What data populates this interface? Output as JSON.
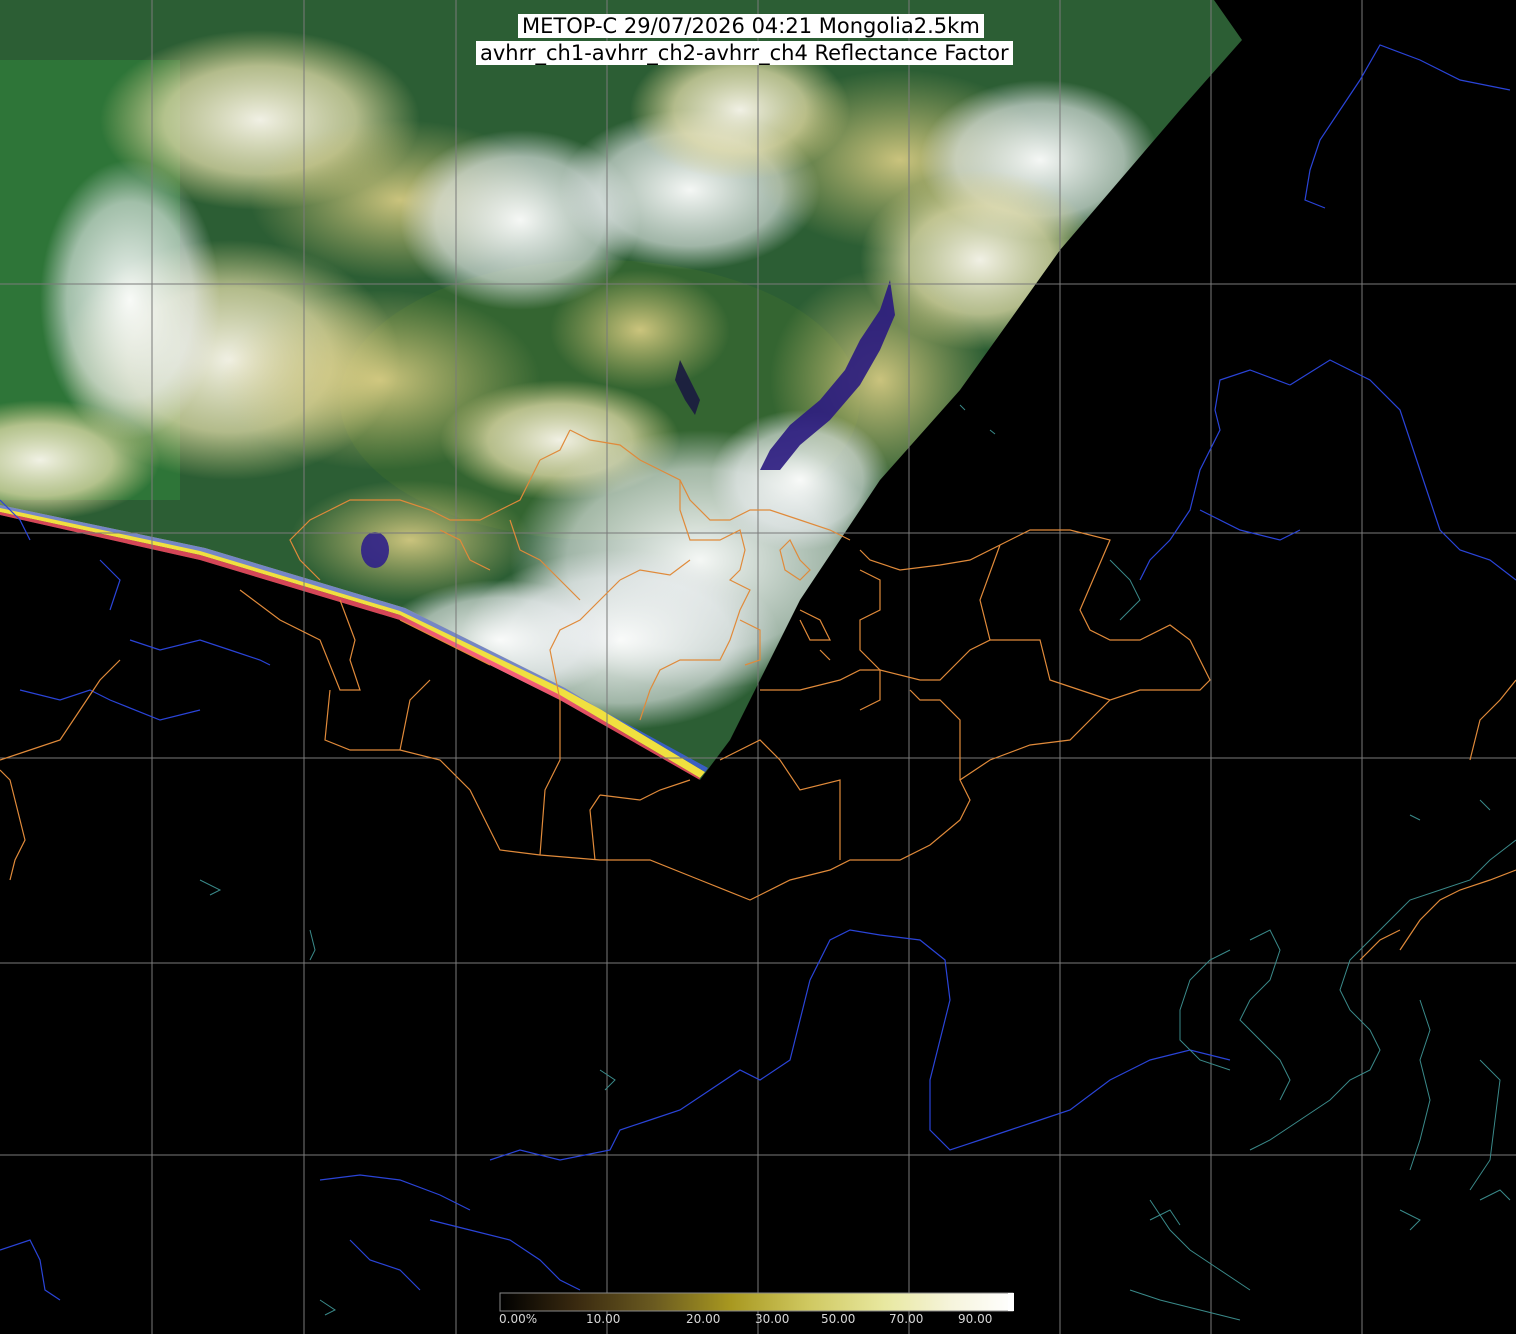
{
  "title": {
    "line1": "METOP-C 29/07/2026 04:21 Mongolia2.5km",
    "line2": "avhrr_ch1-avhrr_ch2-avhrr_ch4 Reflectance Factor"
  },
  "colorbar": {
    "labels": [
      "0.00%",
      "10.00",
      "20.00",
      "30.00",
      "50.00",
      "70.00",
      "90.00"
    ]
  },
  "colors": {
    "background": "#000000",
    "grid": "#7a7a7a",
    "country_border": "#e08a3a",
    "province_border": "#e08a3a",
    "coastline": "#3a8a8a",
    "rivers": "#2a44d8",
    "vegetation": "#2f6e3a",
    "cloud": "#f2ede0",
    "lake": "#2a1a7a"
  }
}
